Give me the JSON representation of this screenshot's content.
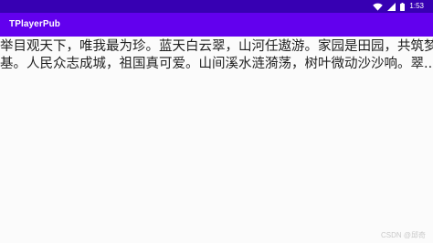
{
  "status_bar": {
    "time": "1:53",
    "icons": [
      "wifi-icon",
      "signal-icon",
      "battery-icon"
    ],
    "color": "#3700b3"
  },
  "app_bar": {
    "title": "TPlayerPub",
    "color": "#6200ee"
  },
  "content": {
    "lines": [
      "举目观天下，唯我最为珍。蓝天白云翠，山河任遨游。家园是田园，共筑梦想",
      "基。人民众志成城，祖国真可爱。山间溪水涟漪荡，树叶微动沙沙响。翠..."
    ]
  },
  "watermark": {
    "text": "CSDN @邱奇"
  }
}
